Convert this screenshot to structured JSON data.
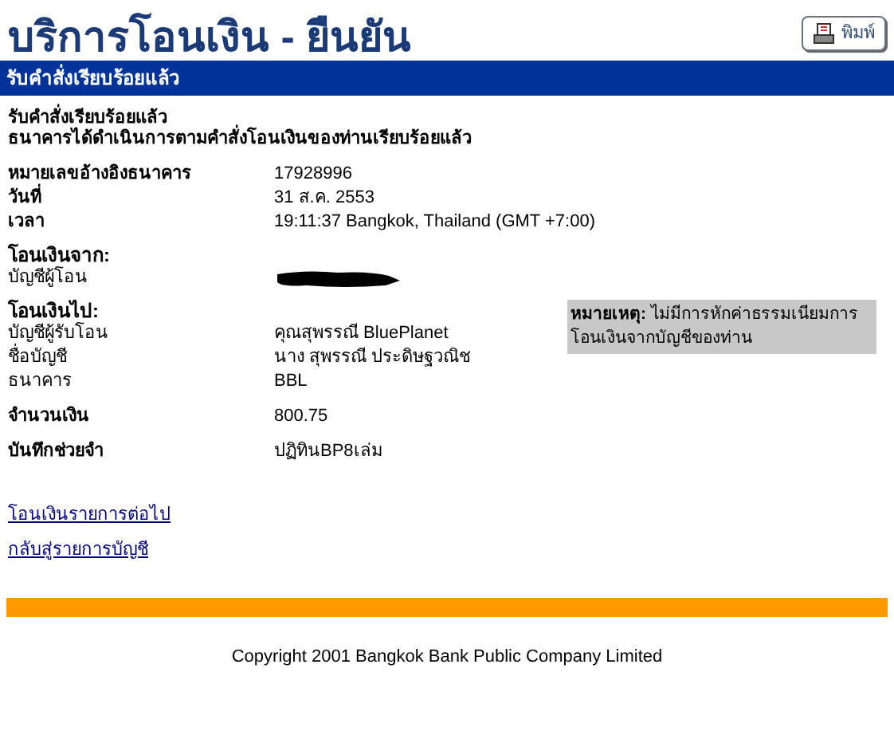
{
  "title": "บริการโอนเงิน - ยืนยัน",
  "print_button": {
    "label": "พิมพ์"
  },
  "header_bar": "รับคำสั่งเรียบร้อยแล้ว",
  "messages": [
    "รับคำสั่งเรียบร้อยแล้ว",
    "ธนาคารได้ดำเนินการตามคำสั่งโอนเงินของท่านเรียบร้อยแล้ว"
  ],
  "rows": [
    {
      "kind": "field",
      "label": "หมายเลขอ้างอิงธนาคาร",
      "value": "17928996",
      "bold": true
    },
    {
      "kind": "field",
      "label": "วันที่",
      "value": "31 ส.ค. 2553",
      "bold": true
    },
    {
      "kind": "field",
      "label": "เวลา",
      "value": "19:11:37 Bangkok, Thailand (GMT +7:00)",
      "bold": true
    },
    {
      "kind": "heading",
      "label": "โอนเงินจาก:"
    },
    {
      "kind": "redacted",
      "label": "บัญชีผู้โอน"
    },
    {
      "kind": "heading",
      "label": "โอนเงินไป:"
    },
    {
      "kind": "field",
      "label": "บัญชีผู้รับโอน",
      "value": "คุณสุพรรณี BluePlanet",
      "bold": false
    },
    {
      "kind": "field",
      "label": "ชื่อบัญชี",
      "value": "นาง สุพรรณี ประดิษฐวณิช",
      "bold": false
    },
    {
      "kind": "field",
      "label": "ธนาคาร",
      "value": "BBL",
      "bold": false
    },
    {
      "kind": "field",
      "label": "จำนวนเงิน",
      "value": "800.75",
      "bold": true
    },
    {
      "kind": "field",
      "label": "บันทึกช่วยจำ",
      "value": "ปฏิทินBP8เล่ม",
      "bold": true
    }
  ],
  "note": "**หมายเหตุ:** ไม่มีการหักค่าธรรมเนียมการโอนเงินจากบัญชีของท่าน",
  "links": [
    "โอนเงินรายการต่อไป",
    "กลับสู่รายการบัญชี"
  ],
  "copyright": "Copyright 2001 Bangkok Bank Public Company Limited"
}
